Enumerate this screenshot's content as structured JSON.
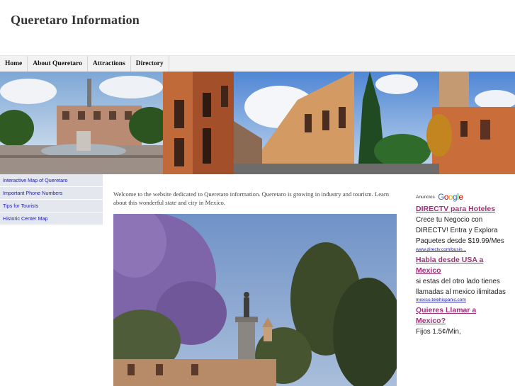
{
  "site": {
    "title": "Queretaro Information"
  },
  "nav": {
    "items": [
      {
        "label": "Home"
      },
      {
        "label": "About Queretaro"
      },
      {
        "label": "Attractions"
      },
      {
        "label": "Directory"
      }
    ]
  },
  "sidebar": {
    "items": [
      {
        "label": "Interactive Map of Queretaro"
      },
      {
        "label": "Important Phone Numbers"
      },
      {
        "label": "Tips for Tourists"
      },
      {
        "label": "Historic Center Map"
      }
    ]
  },
  "main": {
    "intro": "Welcome to the website dedicated to Queretaro information. Queretaro is growing in industry and tourism. Learn about this wonderful state and city in Mexico."
  },
  "ads": {
    "label": "Anuncios",
    "brand": "Google",
    "brand_colors": [
      "#3366cc",
      "#cc0000",
      "#eeaa00",
      "#3366cc",
      "#339933",
      "#cc0000"
    ],
    "items": [
      {
        "title": "DIRECTV para Hoteles",
        "body": "Crece tu Negocio con DIRECTV! Entra y Explora Paquetes desde $19.99/Mes",
        "url": "www.directv.com/busin..."
      },
      {
        "title": "Habla desde USA a Mexico",
        "body": "si estas del otro lado tienes llamadas al mexico ilimitadas",
        "url": "mexico.telehispanic.com"
      },
      {
        "title": "Quieres Llamar a Mexico?",
        "body": "Fijos 1.5¢/Min,"
      }
    ]
  },
  "colors": {
    "nav_bg": "#f2f2f2",
    "sidebar_bg": "#e4e8ee",
    "link_blue": "#1a1ab0",
    "ad_title": "#a0307a"
  }
}
